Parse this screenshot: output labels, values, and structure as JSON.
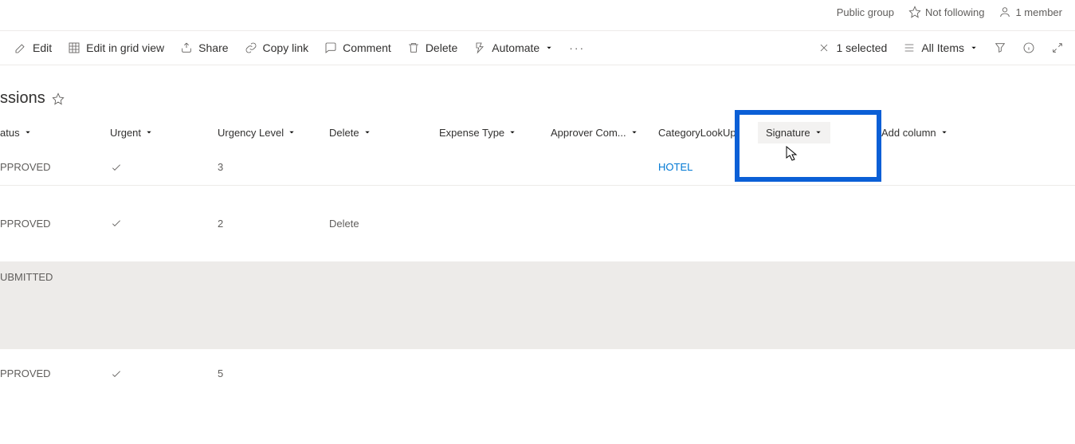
{
  "topbar": {
    "group_type": "Public group",
    "following": "Not following",
    "members": "1 member"
  },
  "commands": {
    "edit": "Edit",
    "grid": "Edit in grid view",
    "share": "Share",
    "copylink": "Copy link",
    "comment": "Comment",
    "delete": "Delete",
    "automate": "Automate",
    "selected": "1 selected",
    "allitems": "All Items"
  },
  "list": {
    "title": "ssions"
  },
  "columns": {
    "status": "atus",
    "urgent": "Urgent",
    "urgency_level": "Urgency Level",
    "delete": "Delete",
    "expense_type": "Expense Type",
    "approver": "Approver Com...",
    "category": "CategoryLookUp",
    "signature": "Signature",
    "add_column": "Add column"
  },
  "rows": [
    {
      "status": "PPROVED",
      "urgent": true,
      "level": "3",
      "delete": "",
      "category": "HOTEL"
    },
    {
      "status": "PPROVED",
      "urgent": true,
      "level": "2",
      "delete": "Delete",
      "category": ""
    },
    {
      "status": "UBMITTED",
      "urgent": false,
      "level": "",
      "delete": "",
      "category": ""
    },
    {
      "status": "PPROVED",
      "urgent": true,
      "level": "5",
      "delete": "",
      "category": ""
    }
  ]
}
